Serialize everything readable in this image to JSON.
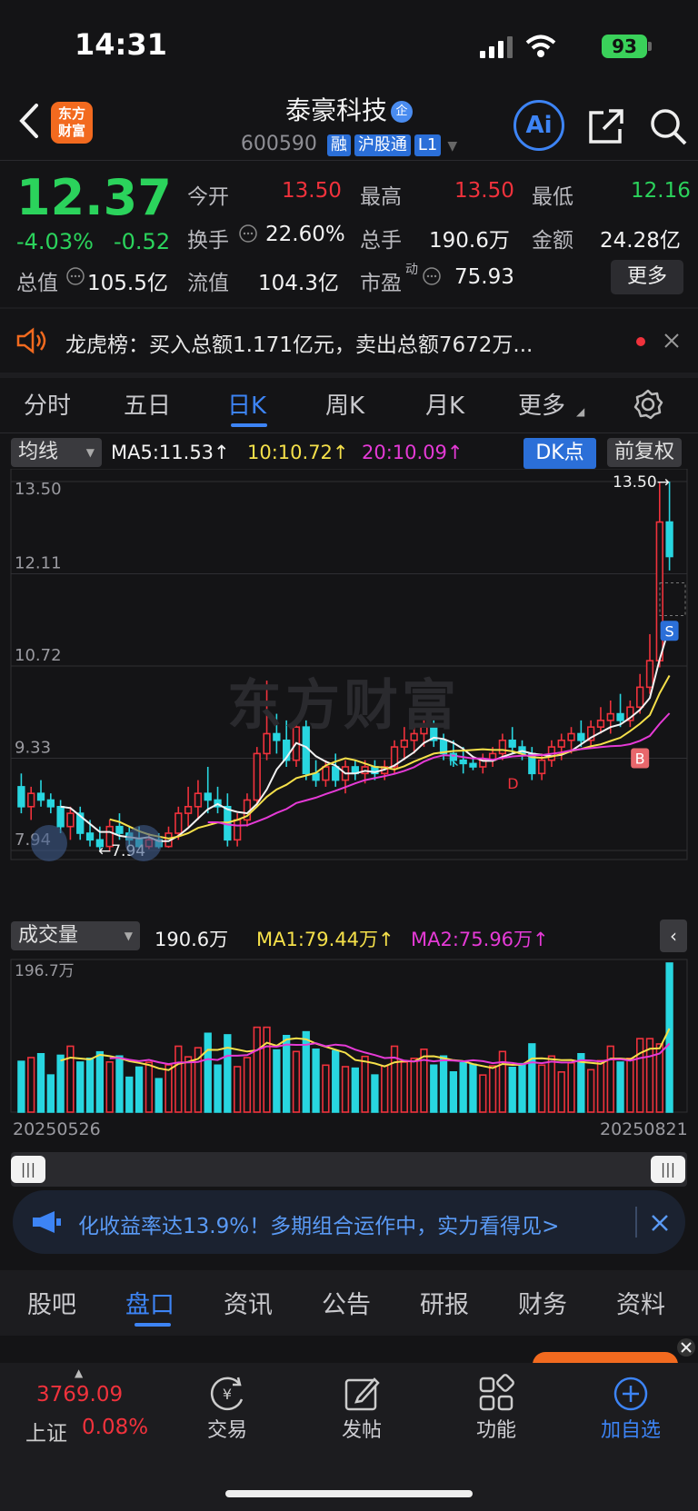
{
  "status": {
    "time": "14:31",
    "battery": "93"
  },
  "header": {
    "title": "泰豪科技",
    "code": "600590",
    "tags": [
      "融",
      "沪股通",
      "L1"
    ],
    "logo_line1": "东方",
    "logo_line2": "财富",
    "ai_label": "Ai"
  },
  "quote": {
    "price": "12.37",
    "pct": "-4.03%",
    "chg": "-0.52",
    "labels": {
      "open": "今开",
      "high": "最高",
      "low": "最低",
      "turnover": "换手",
      "volume": "总手",
      "amount": "金额",
      "mcap": "总值",
      "float": "流值",
      "pe": "市盈"
    },
    "values": {
      "open": "13.50",
      "high": "13.50",
      "low": "12.16",
      "turnover": "22.60%",
      "volume": "190.6万",
      "amount": "24.28亿",
      "mcap": "105.5亿",
      "float": "104.3亿",
      "pe": "75.93"
    },
    "pe_sup": "动",
    "more": "更多"
  },
  "notice": {
    "text": "龙虎榜：买入总额1.171亿元，卖出总额7672万..."
  },
  "ktabs": [
    "分时",
    "五日",
    "日K",
    "周K",
    "月K",
    "更多"
  ],
  "chart": {
    "ma_select": "均线",
    "ma5": "MA5:11.53↑",
    "ma10": "10:10.72↑",
    "ma20": "20:10.09↑",
    "dk": "DK点",
    "adjust": "前复权",
    "price_ticks": [
      "13.50",
      "12.11",
      "10.72",
      "9.33",
      "7.94"
    ],
    "max_label": "13.50→",
    "min_label": "←7.94",
    "watermark": "东方财富",
    "vol_select": "成交量",
    "vol_val": "190.6万",
    "vol_ma1": "MA1:79.44万↑",
    "vol_ma2": "MA2:75.96万↑",
    "vol_max": "196.7万",
    "date_start": "20250526",
    "date_end": "20250821",
    "marker_s": "S",
    "marker_b": "B",
    "marker_k": "K",
    "marker_d": "D"
  },
  "banner": {
    "text": "化收益率达13.9%！多期组合运作中，实力看得见>"
  },
  "ftabs": [
    "股吧",
    "盘口",
    "资讯",
    "公告",
    "研报",
    "财务",
    "资料"
  ],
  "bottom": {
    "index_value": "3769.09",
    "index_name": "上证",
    "index_pct": "0.08%",
    "nav": [
      "交易",
      "发帖",
      "功能",
      "加自选"
    ]
  },
  "chart_data": {
    "type": "candlestick",
    "x_start": "20250526",
    "x_end": "20250821",
    "ylim": [
      7.94,
      13.5
    ],
    "candles": [
      [
        8.9,
        9.1,
        8.5,
        8.6
      ],
      [
        8.6,
        8.9,
        8.4,
        8.8
      ],
      [
        8.8,
        9.0,
        8.6,
        8.7
      ],
      [
        8.7,
        8.8,
        8.5,
        8.6
      ],
      [
        8.6,
        8.7,
        8.2,
        8.3
      ],
      [
        8.3,
        8.6,
        8.1,
        8.5
      ],
      [
        8.5,
        8.6,
        8.1,
        8.2
      ],
      [
        8.2,
        8.4,
        8.0,
        8.1
      ],
      [
        8.1,
        8.3,
        7.95,
        8.0
      ],
      [
        8.0,
        8.4,
        7.94,
        8.3
      ],
      [
        8.3,
        8.5,
        8.1,
        8.2
      ],
      [
        8.2,
        8.3,
        8.0,
        8.1
      ],
      [
        8.1,
        8.3,
        7.98,
        8.0
      ],
      [
        8.0,
        8.2,
        7.96,
        8.1
      ],
      [
        8.1,
        8.2,
        7.97,
        8.0
      ],
      [
        8.0,
        8.3,
        7.98,
        8.2
      ],
      [
        8.2,
        8.6,
        8.1,
        8.5
      ],
      [
        8.5,
        8.9,
        8.3,
        8.6
      ],
      [
        8.6,
        9.0,
        8.4,
        8.8
      ],
      [
        8.8,
        9.2,
        8.5,
        8.7
      ],
      [
        8.7,
        8.9,
        8.5,
        8.6
      ],
      [
        8.6,
        8.8,
        8.0,
        8.1
      ],
      [
        8.1,
        8.5,
        8.0,
        8.4
      ],
      [
        8.4,
        8.8,
        8.3,
        8.7
      ],
      [
        8.7,
        9.5,
        8.6,
        9.4
      ],
      [
        9.4,
        10.5,
        9.3,
        9.7
      ],
      [
        9.7,
        10.0,
        9.4,
        9.6
      ],
      [
        9.6,
        9.9,
        9.2,
        9.3
      ],
      [
        9.3,
        9.9,
        9.2,
        9.8
      ],
      [
        9.8,
        9.9,
        9.0,
        9.1
      ],
      [
        9.1,
        9.3,
        8.9,
        9.0
      ],
      [
        9.0,
        9.3,
        8.9,
        9.2
      ],
      [
        9.2,
        9.4,
        8.9,
        9.0
      ],
      [
        9.0,
        9.3,
        8.8,
        9.2
      ],
      [
        9.2,
        9.3,
        9.0,
        9.1
      ],
      [
        9.1,
        9.3,
        8.95,
        9.2
      ],
      [
        9.2,
        9.3,
        9.0,
        9.1
      ],
      [
        9.1,
        9.3,
        9.0,
        9.2
      ],
      [
        9.2,
        9.6,
        9.1,
        9.5
      ],
      [
        9.5,
        9.8,
        9.3,
        9.6
      ],
      [
        9.6,
        9.8,
        9.4,
        9.7
      ],
      [
        9.7,
        9.9,
        9.5,
        9.8
      ],
      [
        9.8,
        9.9,
        9.5,
        9.6
      ],
      [
        9.6,
        9.7,
        9.3,
        9.4
      ],
      [
        9.4,
        9.6,
        9.2,
        9.3
      ],
      [
        9.3,
        9.5,
        9.1,
        9.25
      ],
      [
        9.25,
        9.35,
        9.15,
        9.2
      ],
      [
        9.2,
        9.4,
        9.1,
        9.3
      ],
      [
        9.3,
        9.5,
        9.2,
        9.4
      ],
      [
        9.4,
        9.7,
        9.3,
        9.6
      ],
      [
        9.6,
        9.8,
        9.4,
        9.5
      ],
      [
        9.5,
        9.6,
        9.3,
        9.4
      ],
      [
        9.4,
        9.5,
        9.0,
        9.1
      ],
      [
        9.1,
        9.4,
        9.0,
        9.3
      ],
      [
        9.3,
        9.6,
        9.2,
        9.5
      ],
      [
        9.5,
        9.7,
        9.3,
        9.6
      ],
      [
        9.6,
        9.8,
        9.4,
        9.7
      ],
      [
        9.7,
        9.9,
        9.5,
        9.6
      ],
      [
        9.6,
        9.9,
        9.5,
        9.8
      ],
      [
        9.8,
        10.1,
        9.7,
        9.9
      ],
      [
        9.9,
        10.2,
        9.7,
        10.0
      ],
      [
        10.0,
        10.3,
        9.8,
        9.9
      ],
      [
        9.9,
        10.2,
        9.8,
        10.1
      ],
      [
        10.1,
        10.6,
        10.0,
        10.4
      ],
      [
        10.4,
        11.2,
        10.3,
        10.8
      ],
      [
        10.8,
        13.5,
        10.7,
        12.89
      ],
      [
        12.89,
        13.5,
        12.16,
        12.37
      ]
    ],
    "volume_max": 196.7
  }
}
